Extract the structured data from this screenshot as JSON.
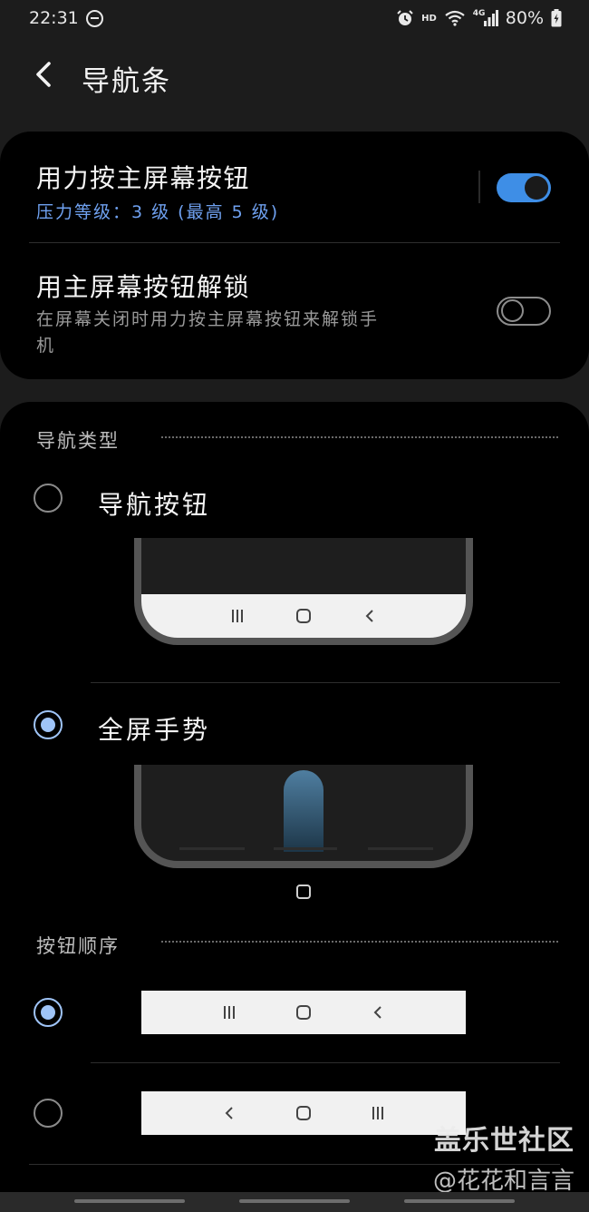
{
  "status_bar": {
    "time": "22:31",
    "hd": "HD",
    "network": "4G",
    "battery": "80%",
    "icons": [
      "do-not-disturb-icon",
      "alarm-icon",
      "wifi-icon",
      "signal-icon",
      "battery-charging-icon"
    ]
  },
  "header": {
    "title": "导航条",
    "back_icon": "back-arrow-icon"
  },
  "settings": {
    "force_press": {
      "title": "用力按主屏幕按钮",
      "subtitle": "压力等级：3 级 (最高 5 级)",
      "enabled": true
    },
    "unlock": {
      "title": "用主屏幕按钮解锁",
      "subtitle_line1": "在屏幕关闭时用力按主屏幕按钮来解锁手",
      "subtitle_line2": "机",
      "enabled": false
    }
  },
  "nav_type": {
    "header": "导航类型",
    "options": [
      {
        "label": "导航按钮",
        "selected": false
      },
      {
        "label": "全屏手势",
        "selected": true
      }
    ]
  },
  "button_order": {
    "header": "按钮顺序",
    "options": [
      {
        "order": [
          "recents-icon",
          "home-icon",
          "back-icon"
        ],
        "selected": true
      },
      {
        "order": [
          "back-icon",
          "home-icon",
          "recents-icon"
        ],
        "selected": false
      }
    ]
  },
  "watermark": {
    "line1": "盖乐世社区",
    "line2": "@花花和言言"
  },
  "colors": {
    "accent": "#3e8ee6",
    "subtitle_blue": "#6fa1f0",
    "radio_selected": "#9fc4f7",
    "card_bg": "#000000",
    "page_bg": "#1c1c1c"
  }
}
